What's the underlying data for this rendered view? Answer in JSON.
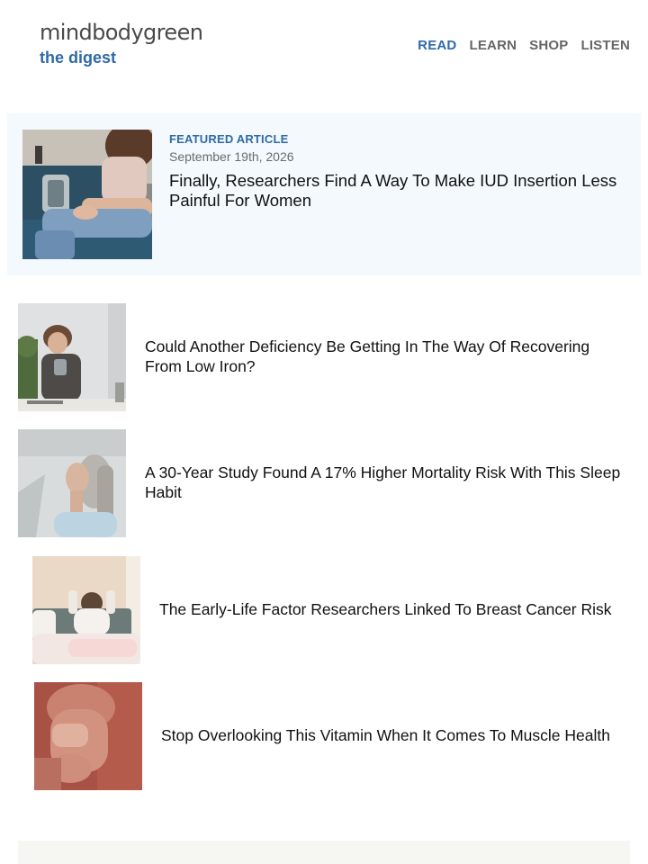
{
  "header": {
    "brand": "mindbodygreen",
    "subtitle": "the digest",
    "nav": [
      {
        "label": "READ",
        "active": true
      },
      {
        "label": "LEARN",
        "active": false
      },
      {
        "label": "SHOP",
        "active": false
      },
      {
        "label": "LISTEN",
        "active": false
      }
    ]
  },
  "featured": {
    "kicker": "FEATURED ARTICLE",
    "date": "September 19th, 2026",
    "title": "Finally, Researchers Find A Way To Make IUD Insertion Less Painful For Women"
  },
  "articles": [
    {
      "title": "Could Another Deficiency Be Getting In The Way Of Recovering From Low Iron?"
    },
    {
      "title": "A 30-Year Study Found A 17% Higher Mortality Risk With This Sleep Habit"
    },
    {
      "title": "The Early-Life Factor Researchers Linked To Breast Cancer Risk"
    },
    {
      "title": "Stop Overlooking This Vitamin When It Comes To Muscle Health"
    }
  ],
  "colors": {
    "brand_blue": "#2f6aa7",
    "featured_bg": "#f3f9fc"
  }
}
